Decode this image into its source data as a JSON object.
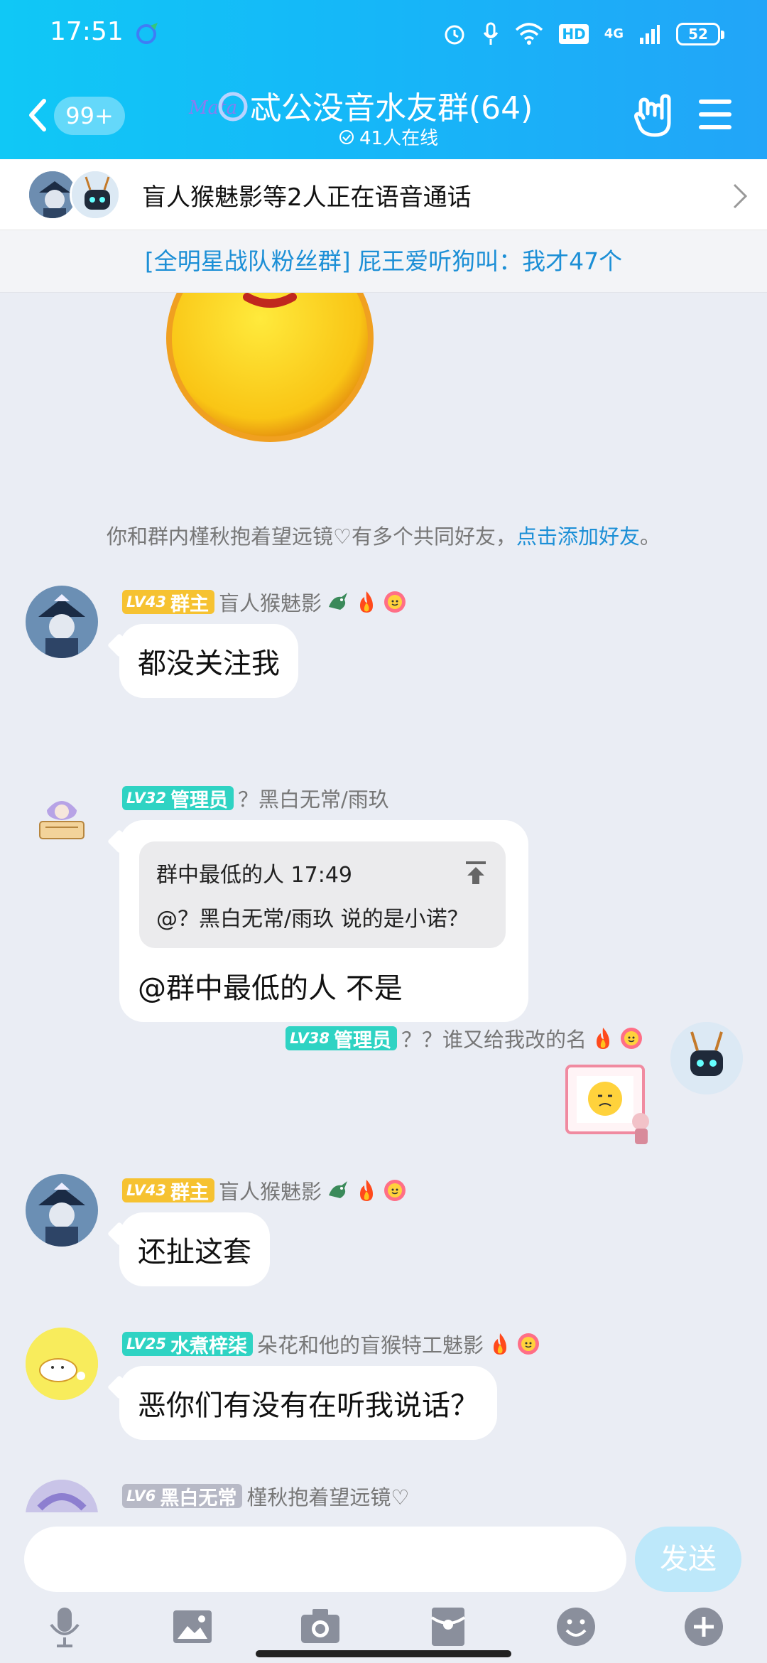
{
  "status": {
    "time": "17:51",
    "hd": "HD",
    "network": "4G",
    "battery": "52"
  },
  "nav": {
    "unread": "99+",
    "title": "忒公没音水友群(64)",
    "online": "41人在线"
  },
  "voice": {
    "text": "盲人猴魅影等2人正在语音通话"
  },
  "notice": {
    "text": "[全明星战队粉丝群] 屁王爱听狗叫：我才47个"
  },
  "system_tip": {
    "text": "你和群内槿秋抱着望远镜♡有多个共同好友，",
    "link": "点击添加好友",
    "end": "。"
  },
  "messages": [
    {
      "level": "LV43",
      "role": "群主",
      "name": "盲人猴魅影",
      "text": "都没关注我"
    },
    {
      "level": "LV32",
      "role": "管理员",
      "name": "？黑白无常/雨玖",
      "quote_head": "群中最低的人 17:49",
      "quote_body": "@？黑白无常/雨玖 说的是小诺？",
      "text": "@群中最低的人 不是"
    },
    {
      "level": "LV38",
      "role": "管理员",
      "name": "？？谁又给我改的名"
    },
    {
      "level": "LV43",
      "role": "群主",
      "name": "盲人猴魅影",
      "text": "还扯这套"
    },
    {
      "level": "LV25",
      "role": "水煮梓柒",
      "name": "朵花和他的盲猴特工魅影",
      "text": "恶你们有没有在听我说话？"
    },
    {
      "level": "LV6",
      "role": "黑白无常",
      "name": "槿秋抱着望远镜♡"
    }
  ],
  "input": {
    "placeholder": "",
    "send": "发送"
  },
  "colors": {
    "header_start": "#10c8f6",
    "header_end": "#22a5f8",
    "link": "#1c8fd6",
    "badge_owner": "#f6c231",
    "badge_admin": "#2fd3c3"
  },
  "icons": {
    "toolbar": [
      "microphone-icon",
      "image-icon",
      "camera-icon",
      "red-packet-icon",
      "emoji-icon",
      "plus-icon"
    ]
  }
}
